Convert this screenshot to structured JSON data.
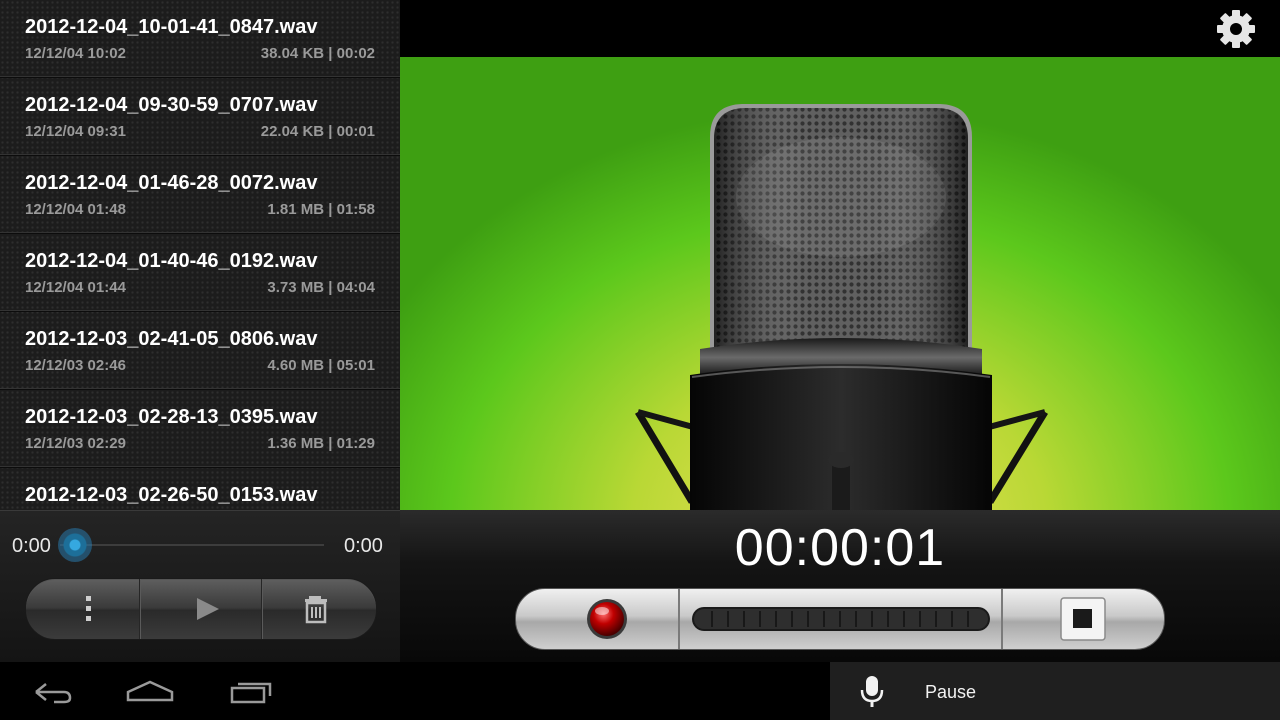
{
  "recordings": [
    {
      "name": "2012-12-04_10-01-41_0847.wav",
      "date": "12/12/04 10:02",
      "meta": "38.04 KB | 00:02"
    },
    {
      "name": "2012-12-04_09-30-59_0707.wav",
      "date": "12/12/04 09:31",
      "meta": "22.04 KB | 00:01"
    },
    {
      "name": "2012-12-04_01-46-28_0072.wav",
      "date": "12/12/04 01:48",
      "meta": "1.81 MB | 01:58"
    },
    {
      "name": "2012-12-04_01-40-46_0192.wav",
      "date": "12/12/04 01:44",
      "meta": "3.73 MB | 04:04"
    },
    {
      "name": "2012-12-03_02-41-05_0806.wav",
      "date": "12/12/03 02:46",
      "meta": "4.60 MB | 05:01"
    },
    {
      "name": "2012-12-03_02-28-13_0395.wav",
      "date": "12/12/03 02:29",
      "meta": "1.36 MB | 01:29"
    },
    {
      "name": "2012-12-03_02-26-50_0153.wav",
      "date": "",
      "meta": ""
    }
  ],
  "player": {
    "current_time": "0:00",
    "total_time": "0:00",
    "progress": 0,
    "buttons": [
      "more-vertical-icon",
      "play-icon",
      "trash-icon"
    ]
  },
  "recorder": {
    "timer": "00:00:01",
    "icons": [
      "record-icon",
      "level-meter",
      "stop-icon"
    ]
  },
  "settings_icon": "gear-icon",
  "notification": {
    "label": "Pause",
    "icon": "microphone-icon"
  },
  "nav": [
    "back-icon",
    "home-icon",
    "recent-apps-icon"
  ],
  "colors": {
    "accent": "#35a8e0",
    "stage_green": "#5cc81c",
    "stage_yellow": "#f0e05a"
  }
}
